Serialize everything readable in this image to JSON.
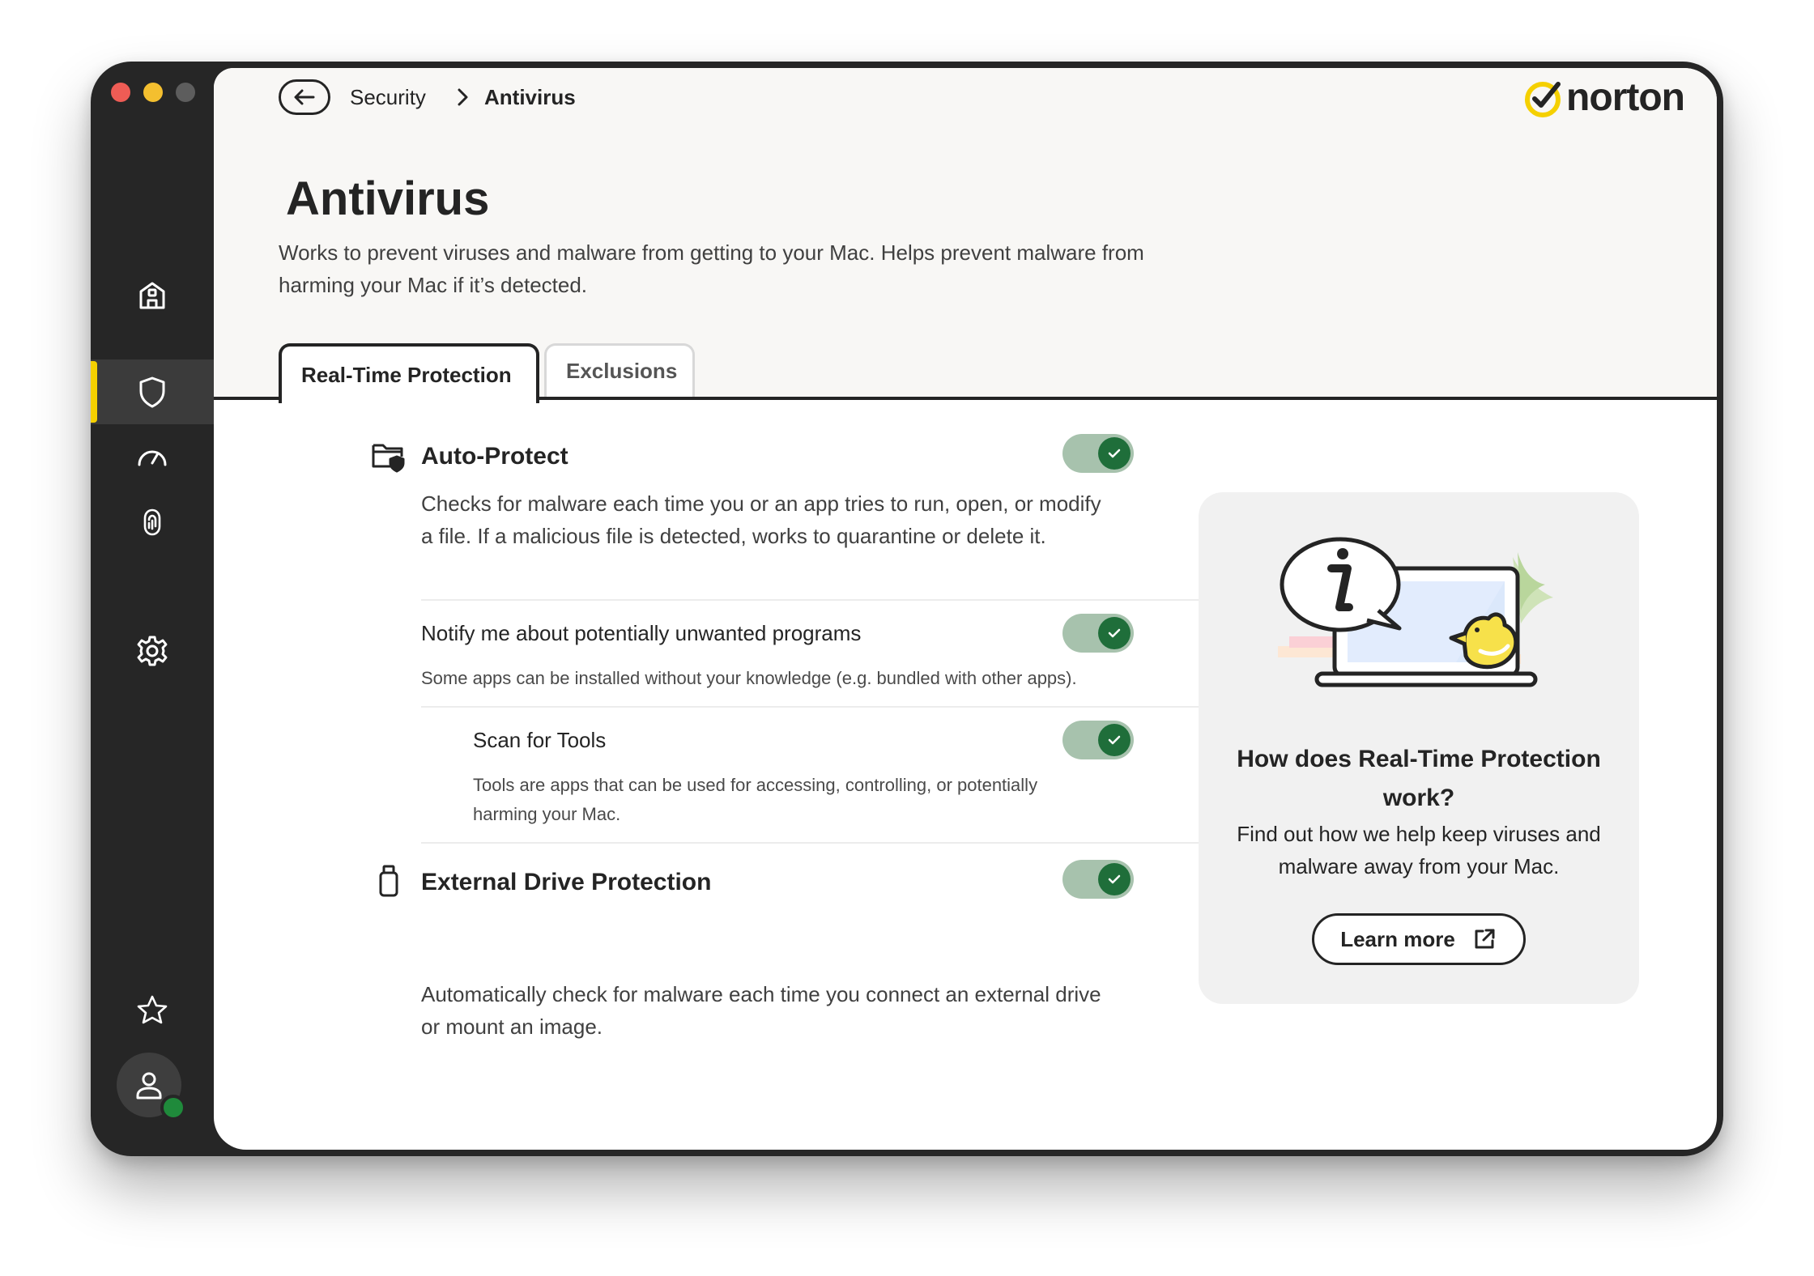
{
  "breadcrumb": {
    "parent": "Security",
    "current": "Antivirus"
  },
  "brand": {
    "name": "norton",
    "accent": "#f5d000"
  },
  "page": {
    "title": "Antivirus",
    "description": "Works to prevent viruses and malware from getting to your Mac. Helps prevent malware from harming your Mac if it’s detected."
  },
  "tabs": [
    {
      "label": "Real-Time Protection",
      "active": true
    },
    {
      "label": "Exclusions",
      "active": false
    }
  ],
  "sidebar": {
    "items": [
      {
        "icon": "home-icon",
        "active": false
      },
      {
        "icon": "shield-icon",
        "active": true
      },
      {
        "icon": "speedometer-icon",
        "active": false
      },
      {
        "icon": "fingerprint-icon",
        "active": false
      },
      {
        "icon": "gear-icon",
        "active": false
      },
      {
        "icon": "star-icon",
        "active": false
      },
      {
        "icon": "user-icon",
        "active": false
      }
    ],
    "status_color": "#1f8a3b"
  },
  "settings": {
    "auto_protect": {
      "title": "Auto-Protect",
      "description": "Checks for malware each time you or an app tries to run, open, or modify a file. If a malicious file is detected, works to quarantine or delete it.",
      "enabled": true
    },
    "pup": {
      "title": "Notify me about potentially unwanted programs",
      "description": "Some apps can be installed without your knowledge (e.g. bundled with other apps).",
      "enabled": true
    },
    "tools": {
      "title": "Scan for Tools",
      "description": "Tools are apps that can be used for accessing, controlling, or potentially harming your Mac.",
      "enabled": true
    },
    "external_drive": {
      "title": "External Drive Protection",
      "description": "Automatically check for malware each time you connect an external drive or mount an image.",
      "enabled": true
    }
  },
  "info_card": {
    "title": "How does Real-Time Protection work?",
    "text": "Find out how we help keep viruses and malware away from your Mac.",
    "button_label": "Learn more"
  }
}
